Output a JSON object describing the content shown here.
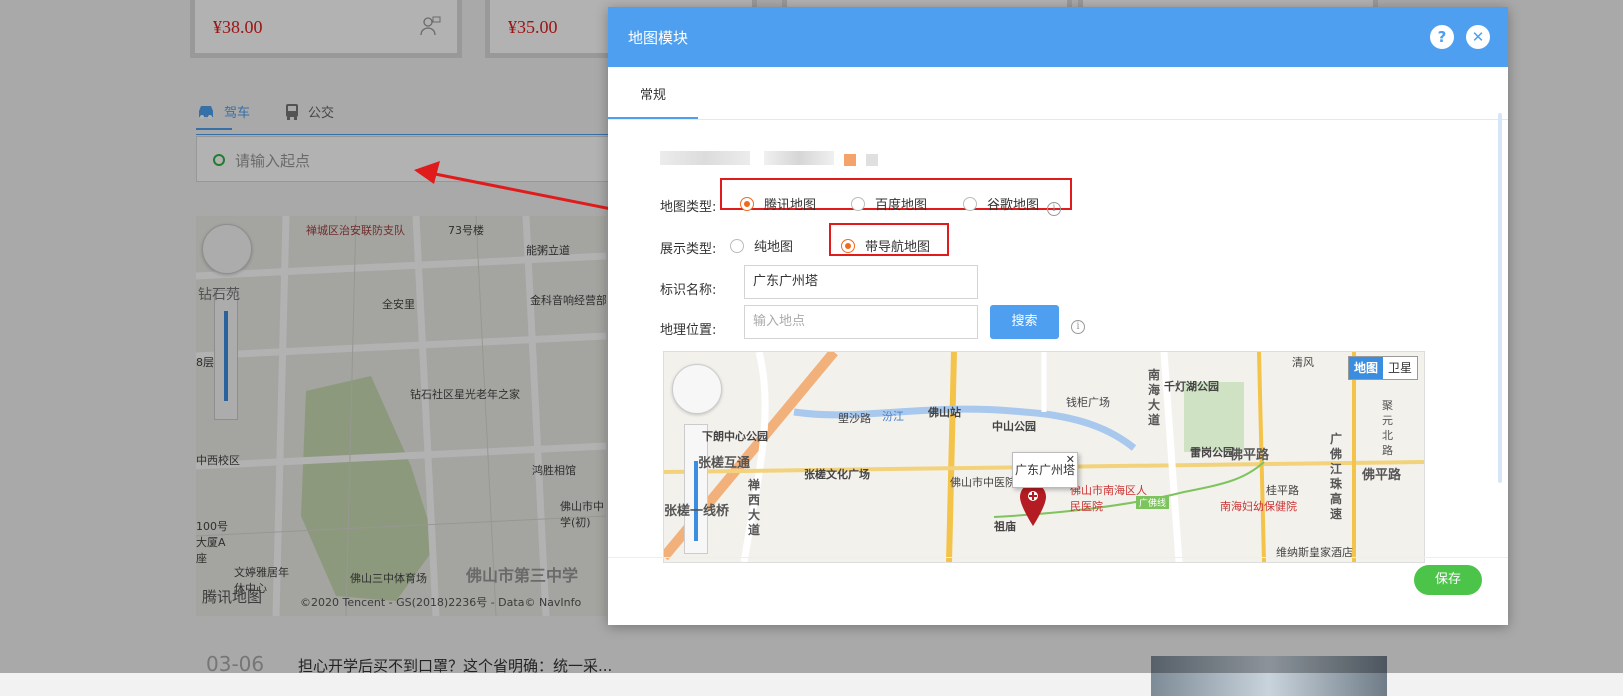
{
  "background": {
    "cards": [
      {
        "price": "¥38.00"
      },
      {
        "price": "¥35.00"
      }
    ],
    "route_tabs": {
      "drive": "驾车",
      "transit": "公交"
    },
    "start_placeholder": "请输入起点",
    "map": {
      "labels": [
        "禅城区治安联防支队",
        "73号楼",
        "全安里",
        "钻石苑",
        "8层",
        "钻石社区星光老年之家",
        "中西校区",
        "鸿胜相馆",
        "佛山市中学(初)",
        "佛山三中体育场",
        "佛山市第三中学",
        "文婷雅居年休中心",
        "100号大厦A座",
        "金科音响经营部",
        "能粥立道"
      ],
      "logo": "腾讯地图",
      "copyright": "©2020 Tencent - GS(2018)2236号 - Data© NavInfo"
    },
    "news": {
      "date": "03-06",
      "title": "担心开学后买不到口罩？这个省明确：统一采..."
    }
  },
  "dialog": {
    "title": "地图模块",
    "help_icon": "question-icon",
    "close_icon": "close-icon",
    "tab": "常规",
    "form": {
      "map_type": {
        "label": "地图类型:",
        "options": [
          "腾讯地图",
          "百度地图",
          "谷歌地图"
        ],
        "selected": "腾讯地图"
      },
      "display_type": {
        "label": "展示类型:",
        "options": [
          "纯地图",
          "带导航地图"
        ],
        "selected": "带导航地图"
      },
      "marker_name": {
        "label": "标识名称:",
        "value": "广东广州塔"
      },
      "location": {
        "label": "地理位置:",
        "placeholder": "输入地点",
        "search_button": "搜索"
      }
    },
    "preview_map": {
      "toggle_map": "地图",
      "toggle_satellite": "卫星",
      "marker_popup": "广东广州塔",
      "labels": [
        "南海大道",
        "千灯湖公园",
        "清风",
        "钱柜广场",
        "佛山站",
        "汾江",
        "塱沙路",
        "中山公园",
        "雷岗公园",
        "佛平路",
        "下朗中心公园",
        "张槎互通",
        "张槎文化广场",
        "佛山市中医院",
        "佛山市南海区人民医院",
        "祖庙",
        "南海妇幼保健院",
        "桂平路",
        "禅西大道",
        "张槎一线桥",
        "维纳斯皇家酒店",
        "广佛江珠高速",
        "聚元北路",
        "佛平路",
        "广佛线"
      ]
    },
    "save_button": "保存"
  }
}
